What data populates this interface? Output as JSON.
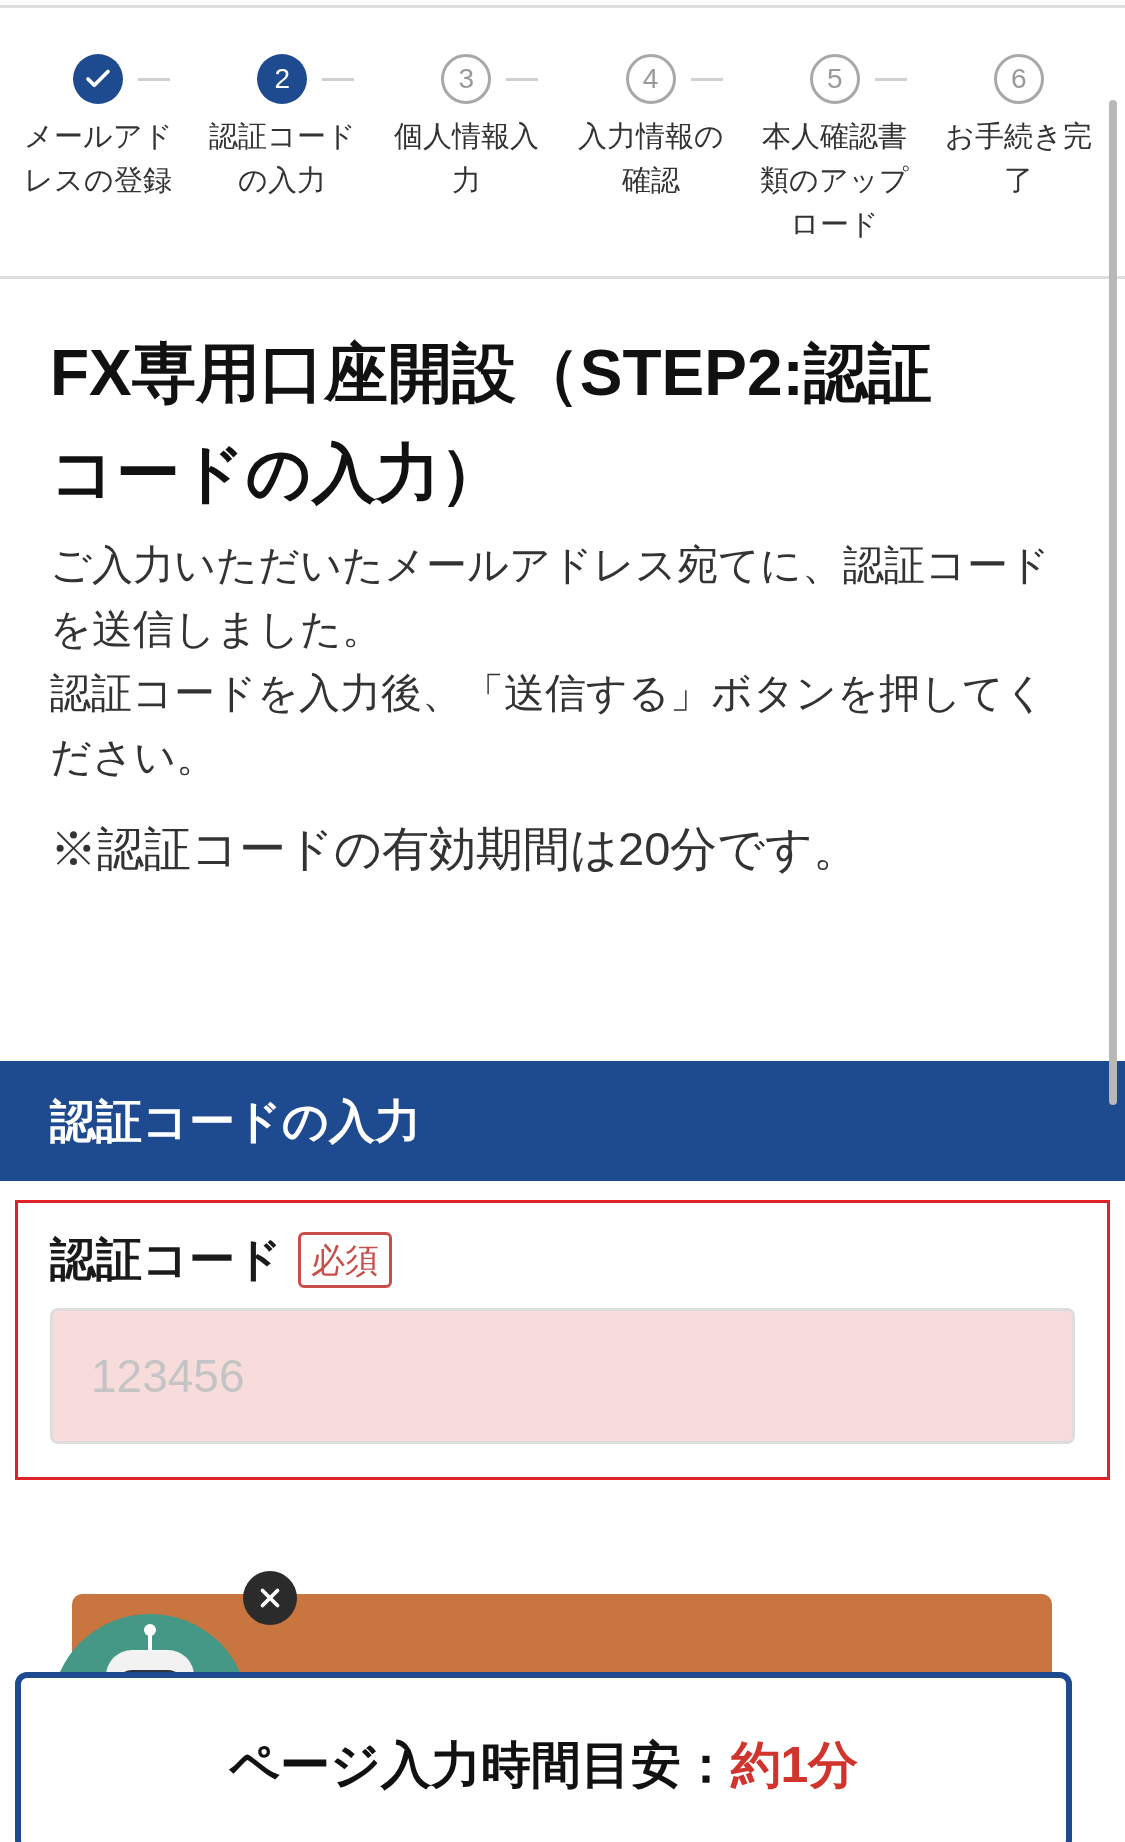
{
  "steps": [
    {
      "label": "メールアドレスの登録",
      "completed": true,
      "selected": false
    },
    {
      "number": "2",
      "label": "認証コードの入力",
      "completed": false,
      "selected": true
    },
    {
      "number": "3",
      "label": "個人情報入力",
      "completed": false,
      "selected": false
    },
    {
      "number": "4",
      "label": "入力情報の確認",
      "completed": false,
      "selected": false
    },
    {
      "number": "5",
      "label": "本人確認書類のアップロード",
      "completed": false,
      "selected": false
    },
    {
      "number": "6",
      "label": "お手続き完了",
      "completed": false,
      "selected": false
    }
  ],
  "title": "FX専用口座開設（STEP2:認証コードの入力）",
  "paragraphs": [
    "ご入力いただいたメールアドレス宛てに、認証コードを送信しました。",
    "認証コードを入力後、「送信する」ボタンを押してください。"
  ],
  "note": "※認証コードの有効期間は20分です。",
  "section": {
    "heading": "認証コードの入力",
    "field": {
      "label": "認証コード",
      "badge": "必須",
      "placeholder": "123456",
      "error": true
    }
  },
  "banner": {
    "label": "ページ入力時間目安：",
    "highlight": "約1分"
  }
}
